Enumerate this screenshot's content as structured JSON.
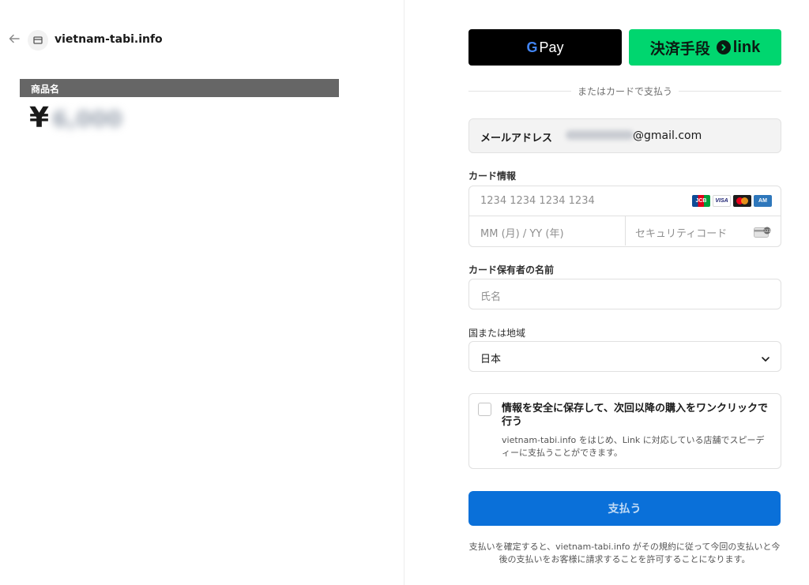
{
  "merchant": {
    "name": "vietnam-tabi.info",
    "icons": {
      "back": "arrow-left-icon",
      "store": "store-icon"
    }
  },
  "product": {
    "label": "商品名",
    "currency_symbol": "¥",
    "price_text": "6,000"
  },
  "wallets": {
    "gpay_g": "G",
    "gpay_label": "Pay",
    "link_prefix": "決済手段",
    "link_word": "link"
  },
  "separator": {
    "text": "またはカードで支払う"
  },
  "email": {
    "label": "メールアドレス",
    "value_suffix": "@gmail.com"
  },
  "card": {
    "section_label": "カード情報",
    "number_placeholder": "1234 1234 1234 1234",
    "expiry_placeholder": "MM (月) / YY (年)",
    "cvc_placeholder": "セキュリティコード",
    "brands": [
      {
        "name": "JCB",
        "icon": "jcb-icon"
      },
      {
        "name": "VISA",
        "icon": "visa-icon"
      },
      {
        "name": "Mastercard",
        "icon": "mastercard-icon"
      },
      {
        "name": "AMEX",
        "icon": "amex-icon"
      }
    ]
  },
  "cardholder": {
    "label": "カード保有者の名前",
    "placeholder": "氏名"
  },
  "country": {
    "label": "国または地域",
    "value": "日本"
  },
  "save_info": {
    "title": "情報を安全に保存して、次回以降の購入をワンクリックで行う",
    "description": "vietnam-tabi.info をはじめ、Link に対応している店舗でスピーディーに支払うことができます。",
    "checked": false
  },
  "pay_button": {
    "label": "支払う"
  },
  "terms": {
    "text": "支払いを確定すると、vietnam-tabi.info がその規約に従って今回の支払いと今後の支払いをお客様に請求することを許可することになります。"
  },
  "colors": {
    "link_green": "#00d66f",
    "pay_blue": "#0a70d9",
    "product_bar": "#666666"
  }
}
